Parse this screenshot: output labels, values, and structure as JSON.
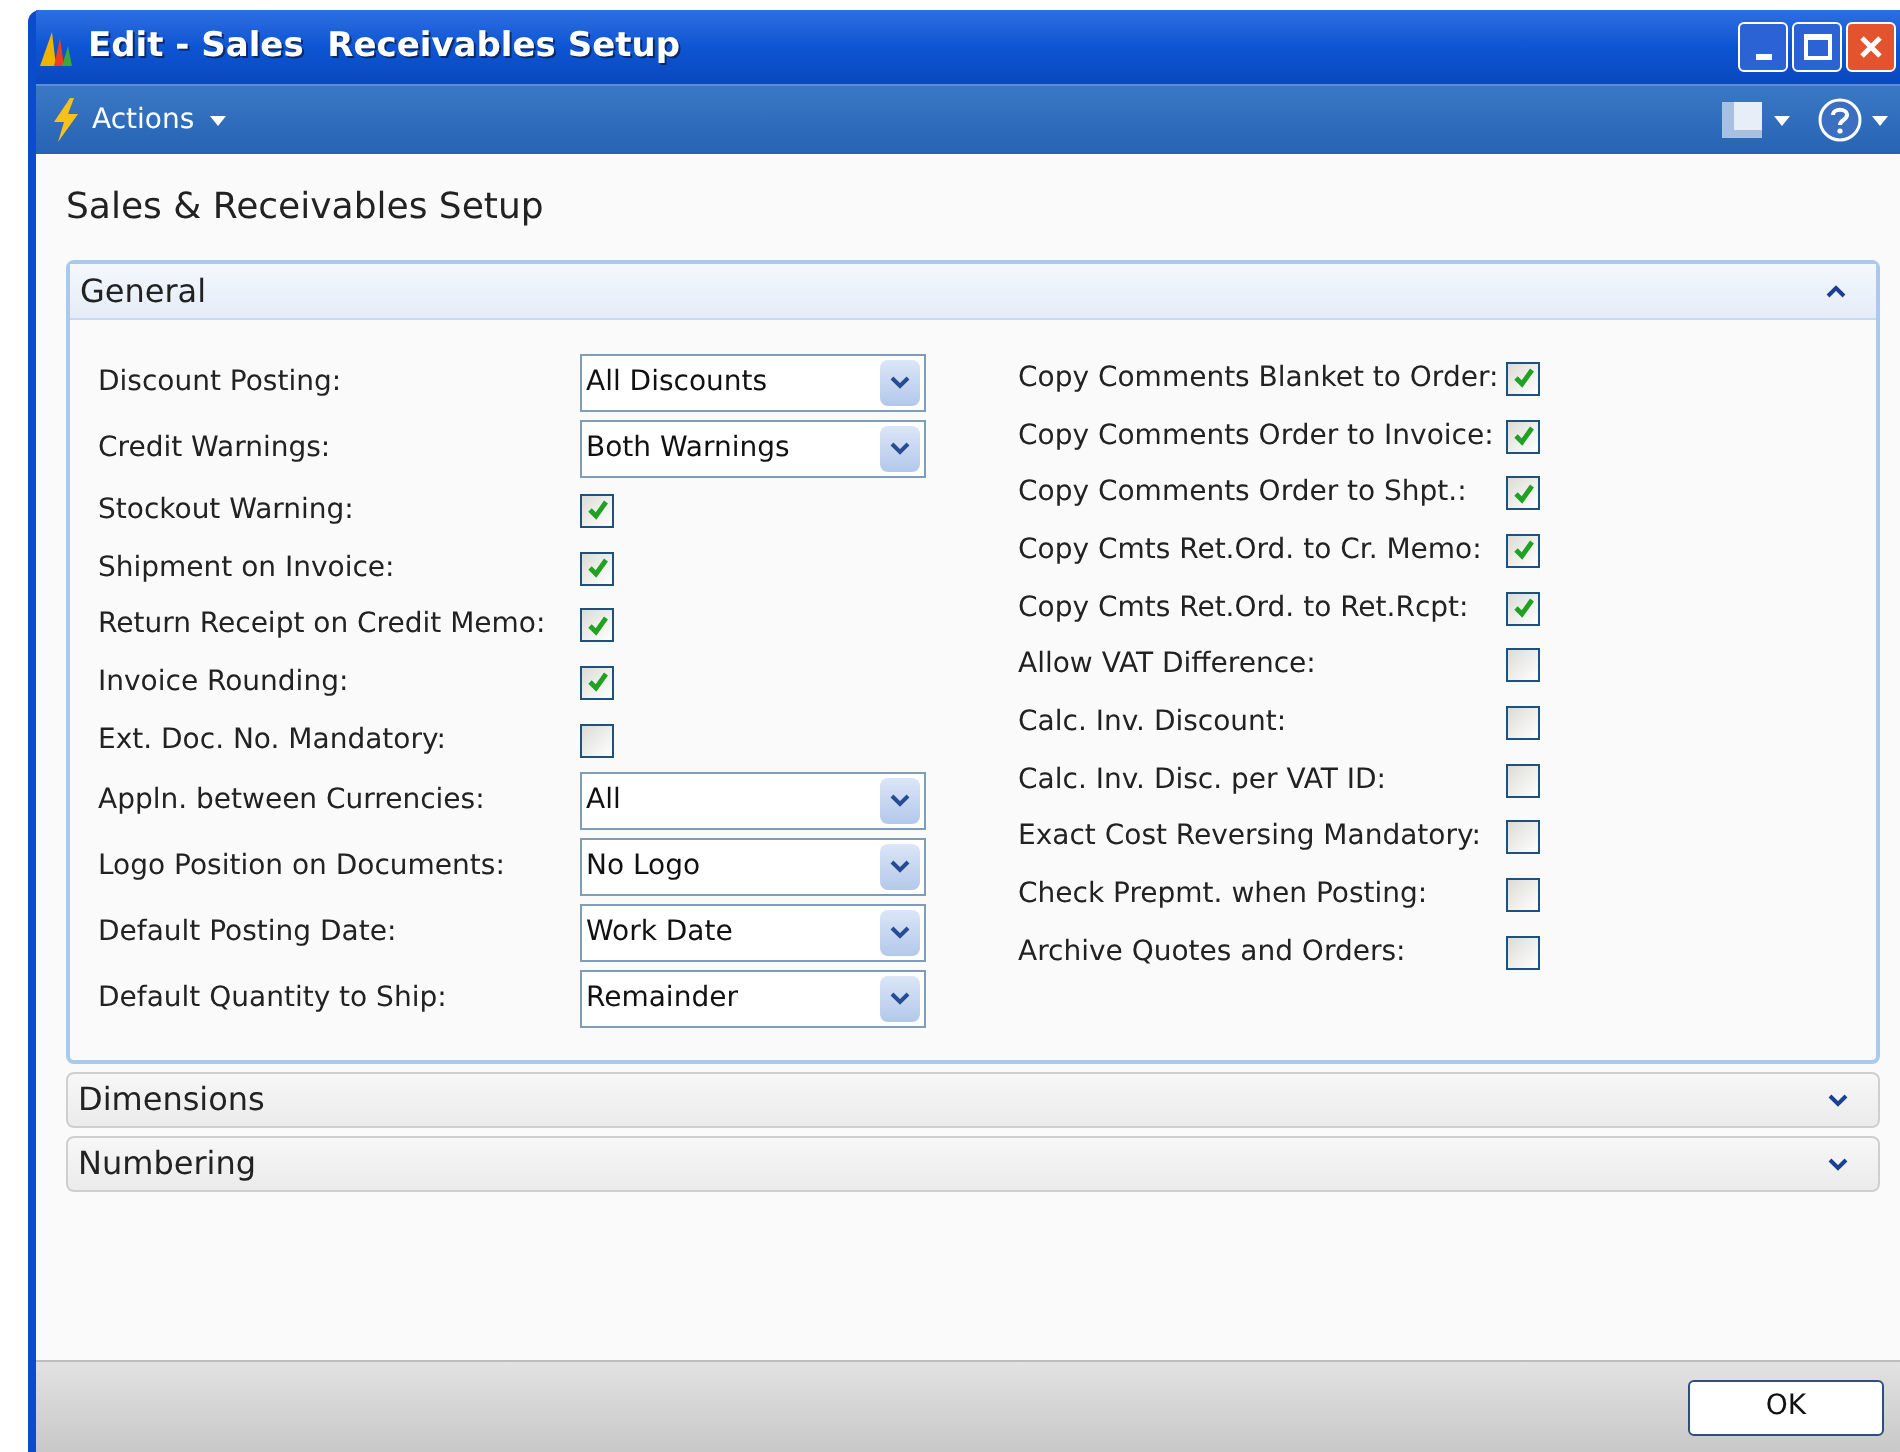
{
  "window": {
    "title": "Edit - Sales  Receivables Setup"
  },
  "toolbar": {
    "actions_label": "Actions"
  },
  "page_title": "Sales & Receivables Setup",
  "sections": [
    {
      "title": "General",
      "expanded": true
    },
    {
      "title": "Dimensions",
      "expanded": false
    },
    {
      "title": "Numbering",
      "expanded": false
    }
  ],
  "general_left": [
    {
      "label": "Discount Posting:",
      "kind": "select",
      "value": "All Discounts"
    },
    {
      "label": "Credit Warnings:",
      "kind": "select",
      "value": "Both Warnings"
    },
    {
      "label": "Stockout Warning:",
      "kind": "checkbox",
      "checked": true
    },
    {
      "label": "Shipment on Invoice:",
      "kind": "checkbox",
      "checked": true
    },
    {
      "label": "Return Receipt on Credit Memo:",
      "kind": "checkbox",
      "checked": true
    },
    {
      "label": "Invoice Rounding:",
      "kind": "checkbox",
      "checked": true
    },
    {
      "label": "Ext. Doc. No. Mandatory:",
      "kind": "checkbox",
      "checked": false
    },
    {
      "label": "Appln. between Currencies:",
      "kind": "select",
      "value": "All"
    },
    {
      "label": "Logo Position on Documents:",
      "kind": "select",
      "value": "No Logo"
    },
    {
      "label": "Default Posting Date:",
      "kind": "select",
      "value": "Work Date"
    },
    {
      "label": "Default Quantity to Ship:",
      "kind": "select",
      "value": "Remainder"
    }
  ],
  "general_right": [
    {
      "label": "Copy Comments Blanket to Order:",
      "kind": "checkbox",
      "checked": true
    },
    {
      "label": "Copy Comments Order to Invoice:",
      "kind": "checkbox",
      "checked": true
    },
    {
      "label": "Copy Comments Order to Shpt.:",
      "kind": "checkbox",
      "checked": true
    },
    {
      "label": "Copy Cmts Ret.Ord. to Cr. Memo:",
      "kind": "checkbox",
      "checked": true
    },
    {
      "label": "Copy Cmts Ret.Ord. to Ret.Rcpt:",
      "kind": "checkbox",
      "checked": true
    },
    {
      "label": "Allow VAT Difference:",
      "kind": "checkbox",
      "checked": false
    },
    {
      "label": "Calc. Inv. Discount:",
      "kind": "checkbox",
      "checked": false
    },
    {
      "label": "Calc. Inv. Disc. per VAT ID:",
      "kind": "checkbox",
      "checked": false
    },
    {
      "label": "Exact Cost Reversing Mandatory:",
      "kind": "checkbox",
      "checked": false
    },
    {
      "label": "Check Prepmt. when Posting:",
      "kind": "checkbox",
      "checked": false
    },
    {
      "label": "Archive Quotes and Orders:",
      "kind": "checkbox",
      "checked": false
    }
  ],
  "buttons": [
    "OK"
  ]
}
